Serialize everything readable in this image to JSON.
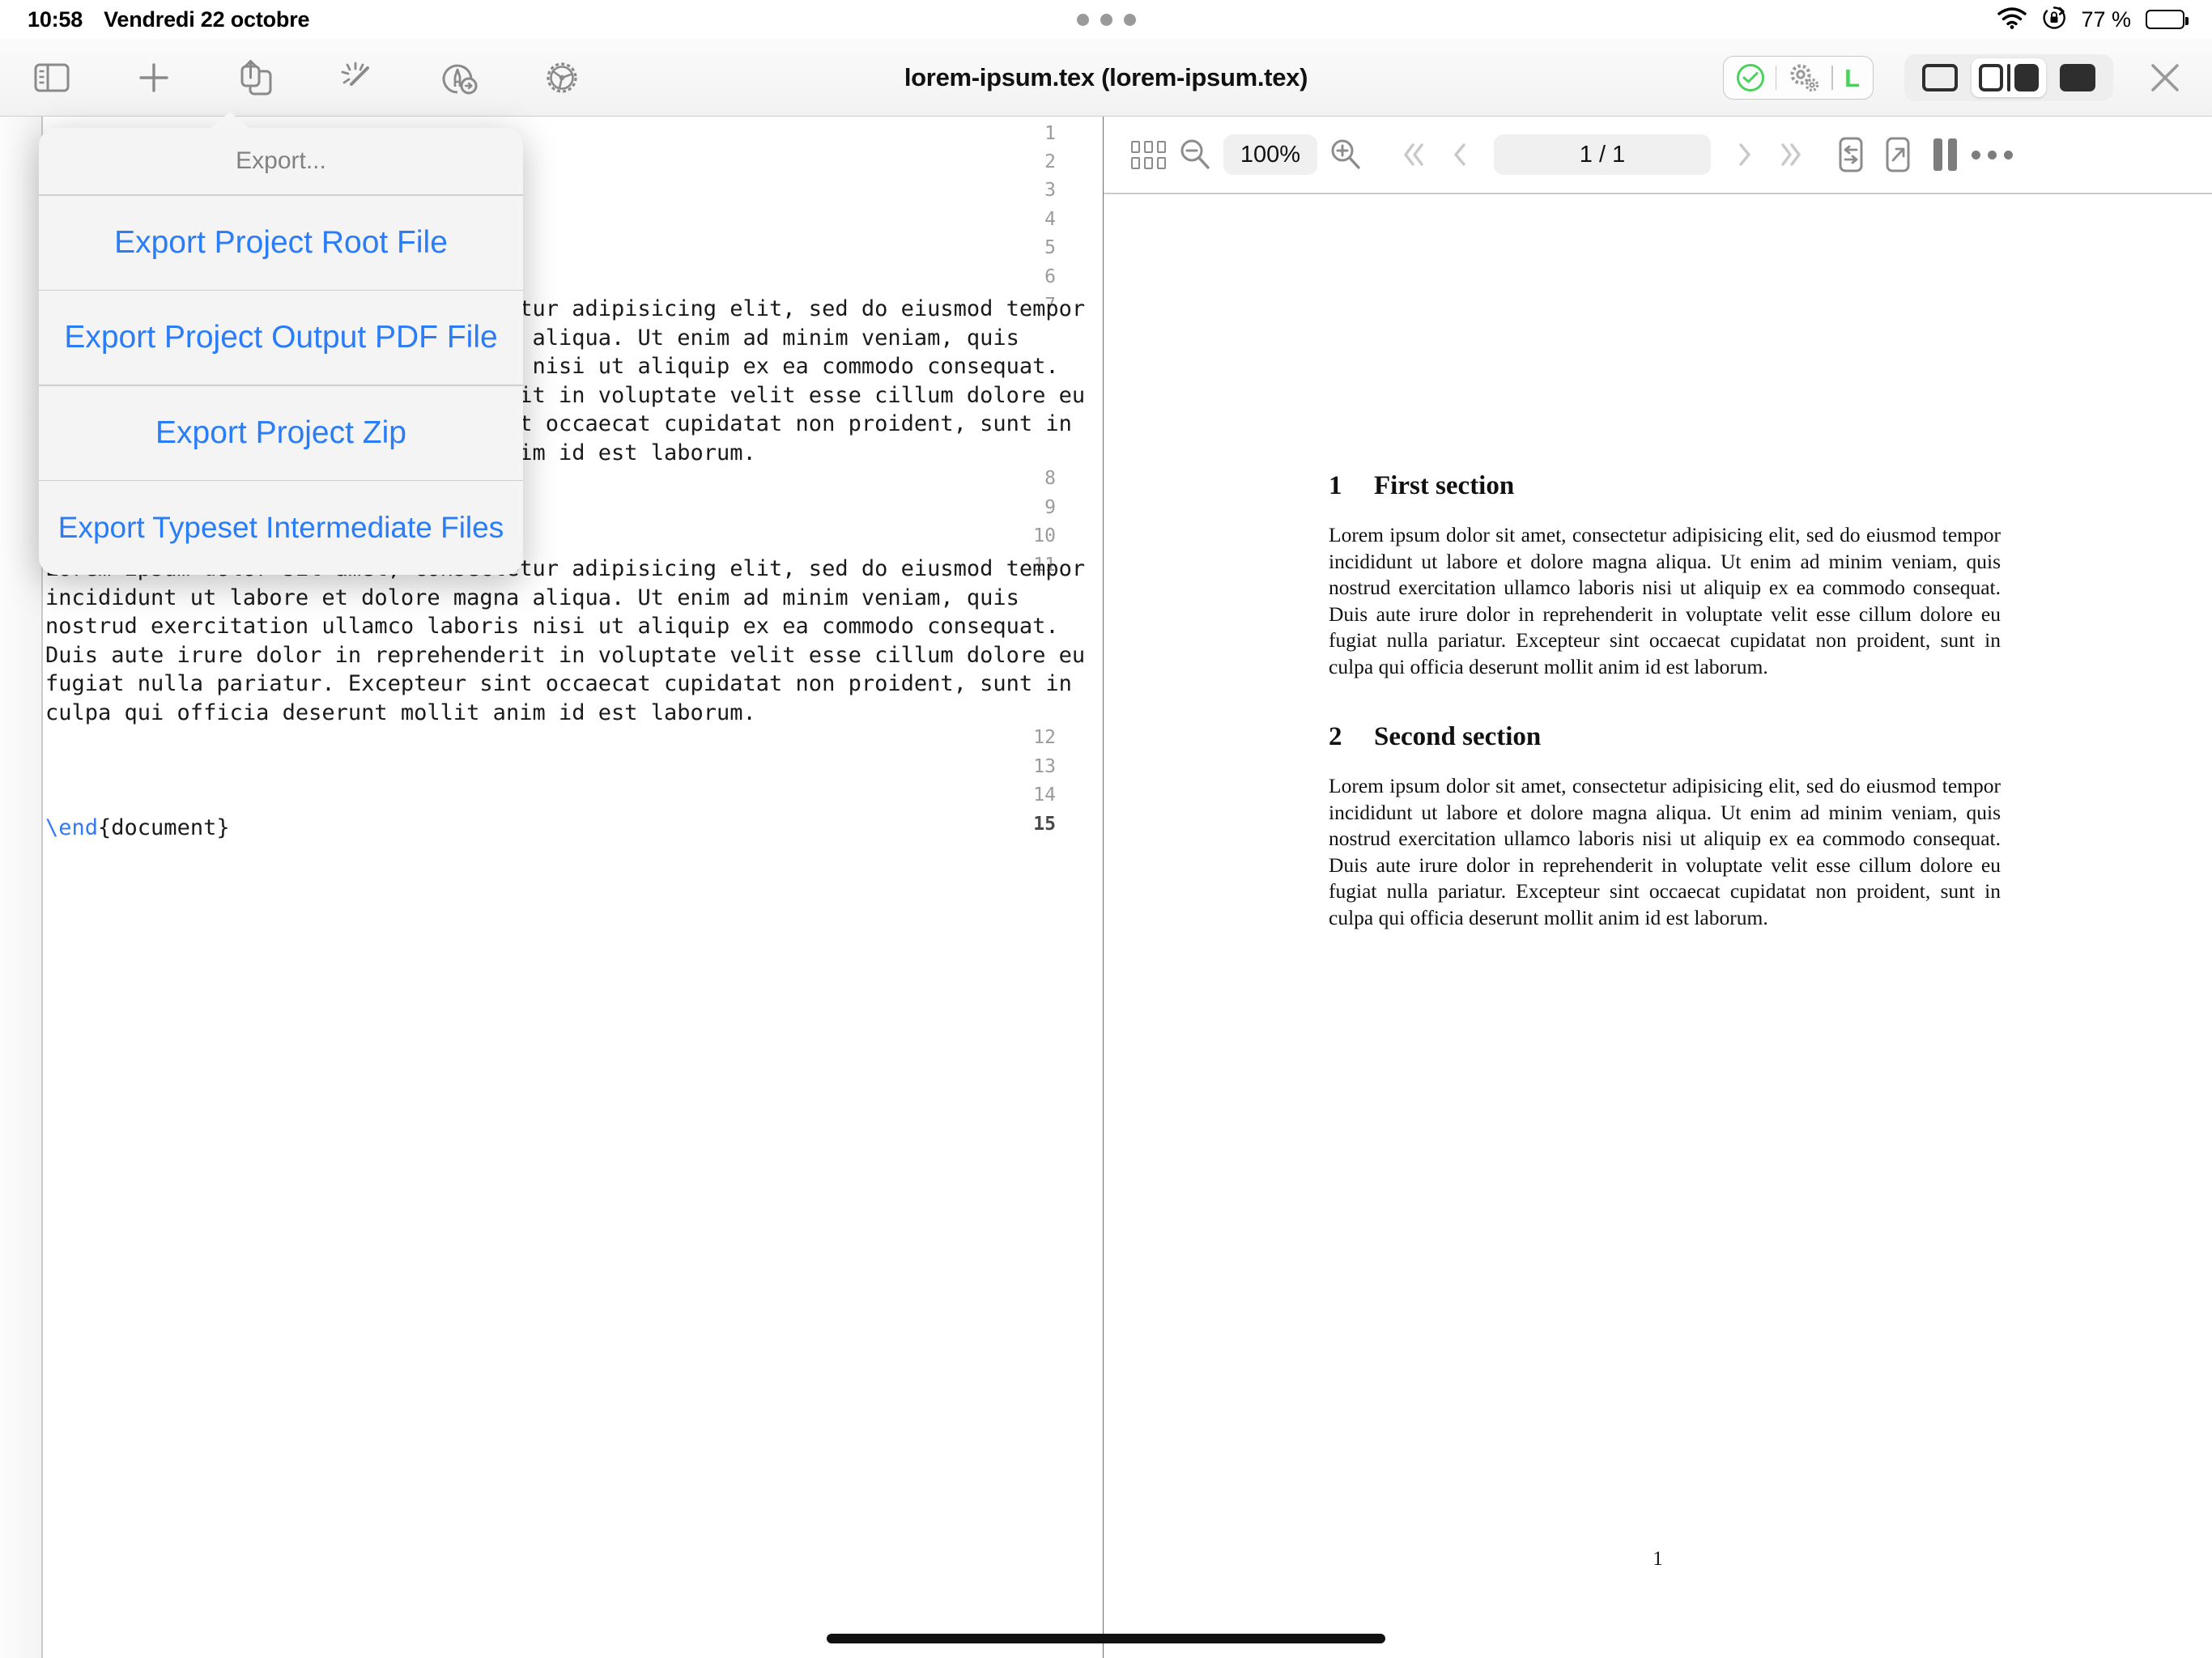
{
  "status_bar": {
    "time": "10:58",
    "date": "Vendredi 22 octobre",
    "battery_percent": "77 %",
    "icons": [
      "wifi-icon",
      "rotation-lock-icon",
      "battery-icon"
    ]
  },
  "toolbar": {
    "title": "lorem-ipsum.tex (lorem-ipsum.tex)",
    "left_buttons": [
      {
        "name": "sidebar-toggle-button",
        "icon": "sidebar-icon"
      },
      {
        "name": "add-button",
        "icon": "plus-icon"
      },
      {
        "name": "export-share-button",
        "icon": "share-icon"
      },
      {
        "name": "clean-button",
        "icon": "magic-wand-icon"
      },
      {
        "name": "typeset-button",
        "icon": "typeset-pen-icon"
      },
      {
        "name": "settings-button",
        "icon": "gear-icon"
      }
    ],
    "status_pill": {
      "check_state": "ok",
      "engine_letter": "L",
      "check_color": "#4cd15f",
      "engine_color": "#4cd15f"
    },
    "layout_segments": [
      {
        "name": "layout-editor-only",
        "selected": false
      },
      {
        "name": "layout-split",
        "selected": true
      },
      {
        "name": "layout-preview-only",
        "selected": false
      }
    ],
    "close_label": "×"
  },
  "export_popover": {
    "title": "Export...",
    "items": [
      "Export Project Root File",
      "Export Project Output PDF File",
      "Export Project Zip",
      "Export Typeset Intermediate Files"
    ]
  },
  "editor": {
    "line_numbers": [
      "1",
      "2",
      "3",
      "4",
      "5",
      "6",
      "7",
      "8",
      "9",
      "10",
      "11",
      "12",
      "13",
      "14",
      "15"
    ],
    "current_line": "15",
    "hidden_paragraph": "Lorem ipsum dolor sit amet, consectetur adipisicing elit, sed do eiusmod tempor incididunt ut labore et dolore magna aliqua. Ut enim ad minim veniam, quis nostrud exercitation ullamco laboris nisi ut aliquip ex ea commodo consequat. Duis aute irure dolor in reprehenderit in voluptate velit esse cillum dolore eu fugiat nulla pariatur. Excepteur sint occaecat cupidatat non proident, sunt in culpa qui officia deserunt mollit anim id est laborum.",
    "paragraph": "Lorem ipsum dolor sit amet, consectetur adipisicing elit, sed do eiusmod tempor incididunt ut labore et dolore magna aliqua. Ut enim ad minim veniam, quis nostrud exercitation ullamco laboris nisi ut aliquip ex ea commodo consequat. Duis aute irure dolor in reprehenderit in voluptate velit esse cillum dolore eu fugiat nulla pariatur. Excepteur sint occaecat cupidatat non proident, sunt in culpa qui officia deserunt mollit anim id est laborum.",
    "end_command": "\\end",
    "end_argument": "{document}"
  },
  "pdf_toolbar": {
    "zoom_level": "100%",
    "page_indicator": "1 / 1",
    "buttons": [
      {
        "name": "thumbnails-grid-button",
        "icon": "grid-icon"
      },
      {
        "name": "zoom-out-button",
        "icon": "magnifier-minus-icon"
      },
      {
        "name": "zoom-in-button",
        "icon": "magnifier-plus-icon"
      },
      {
        "name": "first-page-button",
        "icon": "double-chevron-left-icon",
        "disabled": true
      },
      {
        "name": "previous-page-button",
        "icon": "chevron-left-icon",
        "disabled": true
      },
      {
        "name": "next-page-button",
        "icon": "chevron-right-icon",
        "disabled": true
      },
      {
        "name": "last-page-button",
        "icon": "double-chevron-right-icon",
        "disabled": true
      },
      {
        "name": "sync-source-button",
        "icon": "sync-arrows-icon"
      },
      {
        "name": "open-external-button",
        "icon": "external-link-icon"
      },
      {
        "name": "two-page-view-button",
        "icon": "two-column-icon"
      },
      {
        "name": "more-options-button",
        "icon": "ellipsis-icon"
      }
    ]
  },
  "pdf_document": {
    "sections": [
      {
        "number": "1",
        "heading": "First section",
        "body": "Lorem ipsum dolor sit amet, consectetur adipisicing elit, sed do eiusmod tempor incididunt ut labore et dolore magna aliqua. Ut enim ad minim veniam, quis nostrud exercitation ullamco laboris nisi ut aliquip ex ea commodo consequat. Duis aute irure dolor in reprehenderit in voluptate velit esse cillum dolore eu fugiat nulla pariatur. Excepteur sint occaecat cupidatat non proident, sunt in culpa qui officia deserunt mollit anim id est laborum."
      },
      {
        "number": "2",
        "heading": "Second section",
        "body": "Lorem ipsum dolor sit amet, consectetur adipisicing elit, sed do eiusmod tempor incididunt ut labore et dolore magna aliqua. Ut enim ad minim veniam, quis nostrud exercitation ullamco laboris nisi ut aliquip ex ea commodo consequat. Duis aute irure dolor in reprehenderit in voluptate velit esse cillum dolore eu fugiat nulla pariatur. Excepteur sint occaecat cupidatat non proident, sunt in culpa qui officia deserunt mollit anim id est laborum."
      }
    ],
    "folio": "1"
  },
  "colors": {
    "accent_blue": "#2a7cf7",
    "success_green": "#4cd15f",
    "toolbar_icon_gray": "#8a8a8a"
  }
}
